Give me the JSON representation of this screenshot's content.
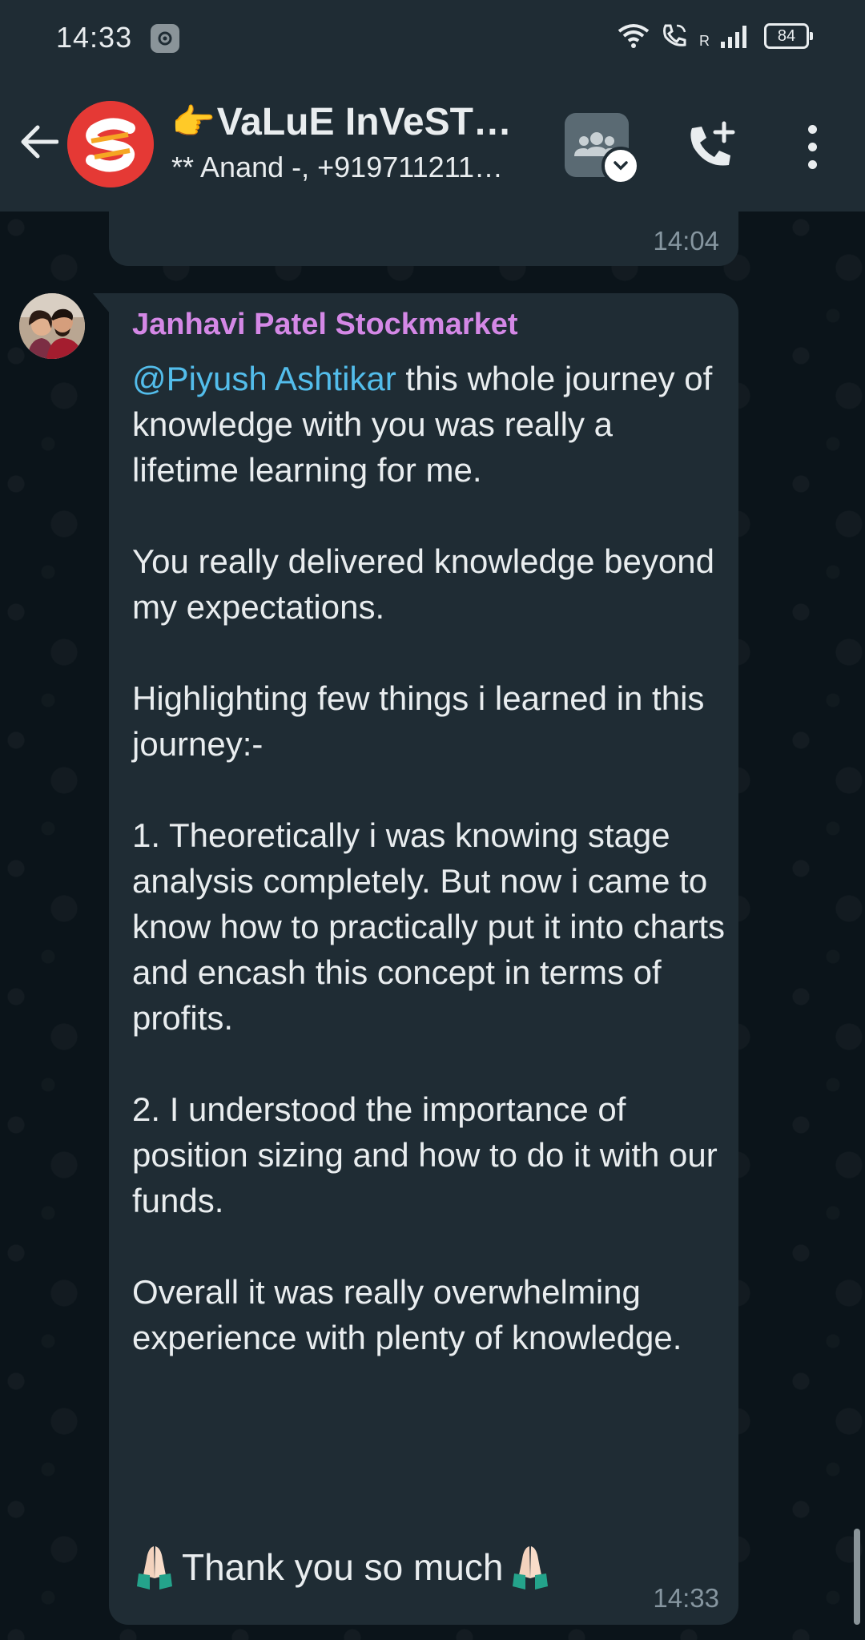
{
  "status_bar": {
    "time": "14:33",
    "battery": "84",
    "carrier_indicator": "R",
    "icons": [
      "settings-icon",
      "wifi-icon",
      "wifi-calling-icon",
      "signal-icon",
      "battery-icon"
    ]
  },
  "header": {
    "group_name": "VaLuE InVeST…",
    "group_name_emoji": "👉",
    "members": "** Anand -, +919711211…",
    "icons": [
      "back-arrow-icon",
      "community-icon",
      "add-call-icon",
      "more-vert-icon"
    ]
  },
  "previous_message": {
    "time": "14:04"
  },
  "message": {
    "sender": "Janhavi Patel Stockmarket",
    "mention": "@Piyush Ashtikar",
    "paragraphs": [
      " this whole journey of knowledge with you was really a lifetime learning for me.",
      "You really delivered knowledge beyond my expectations.",
      "Highlighting few things i learned in this journey:-",
      "1. Theoretically i was knowing stage analysis completely. But now i came to know how to practically put it into charts and encash this concept in terms of profits.",
      "2. I understood the importance of position sizing and how to do it with our funds.",
      "Overall it was really overwhelming experience with plenty of knowledge."
    ],
    "closing": "Thank you so much",
    "time": "14:33"
  },
  "colors": {
    "chat_background": "#0b141a",
    "bubble": "#1f2c34",
    "sender_name": "#d488e6",
    "mention": "#53bdeb",
    "timestamp": "#8696a0",
    "avatar_red": "#e53935"
  }
}
